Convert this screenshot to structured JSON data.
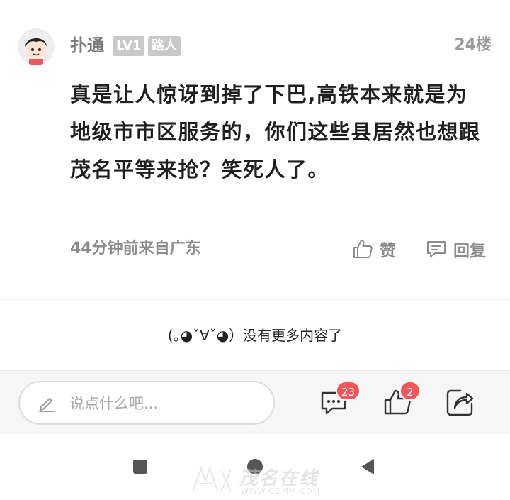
{
  "comment": {
    "username": "扑通",
    "level_badge": "LV1",
    "role_badge": "路人",
    "floor": "24楼",
    "text": "真是让人惊讶到掉了下巴,高铁本来就是为地级市市区服务的，你们这些县居然也想跟茂名平等来抢？笑死人了。",
    "time_location": "44分钟前来自广东",
    "like_label": "赞",
    "reply_label": "回复"
  },
  "end_notice": "(｡◕ˇ∀ˇ◕）没有更多内容了",
  "bottom_bar": {
    "input_placeholder": "说点什么吧...",
    "comment_count": "23",
    "like_count": "2"
  },
  "watermark": {
    "brand": "茂名在线",
    "url": "WWW.GDMM.COM"
  },
  "colors": {
    "badge_red": "#f0565c",
    "badge_gray": "#c9c9c9",
    "muted_text": "#8c8c8c"
  },
  "icons": [
    "avatar",
    "thumbs-up-icon",
    "comment-bubble-icon",
    "pen-icon",
    "share-icon",
    "nav-recents-icon",
    "nav-home-icon",
    "nav-back-icon"
  ]
}
